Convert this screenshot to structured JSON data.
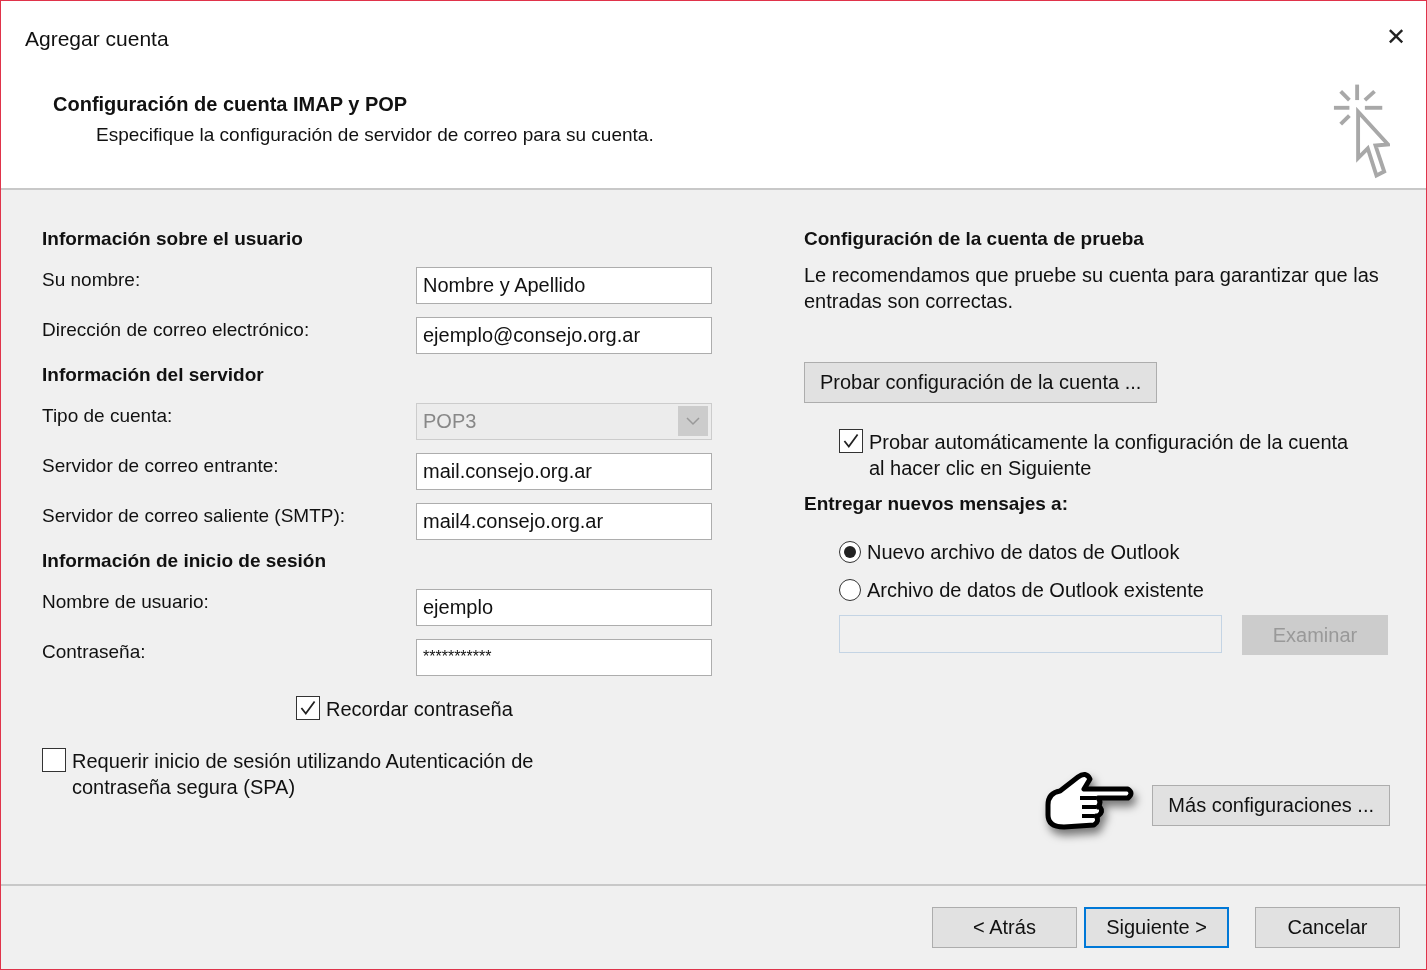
{
  "window": {
    "title": "Agregar cuenta",
    "close": "✕"
  },
  "header": {
    "title": "Configuración de cuenta IMAP y POP",
    "subtitle": "Especifique la configuración de servidor de correo para su cuenta."
  },
  "sections": [
    {
      "heading": "Información sobre el usuario",
      "fields": [
        {
          "kind": "text",
          "label": "Su nombre:",
          "value": "Nombre y Apellido"
        },
        {
          "kind": "text",
          "label": "Dirección de correo electrónico:",
          "value": "ejemplo@consejo.org.ar"
        }
      ]
    },
    {
      "heading": "Información del servidor",
      "fields": [
        {
          "kind": "combo",
          "label": "Tipo de cuenta:",
          "value": "POP3",
          "disabled": true
        },
        {
          "kind": "text",
          "label": "Servidor de correo entrante:",
          "value": "mail.consejo.org.ar"
        },
        {
          "kind": "text",
          "label": "Servidor de correo saliente (SMTP):",
          "value": "mail4.consejo.org.ar"
        }
      ]
    },
    {
      "heading": "Información de inicio de sesión",
      "fields": [
        {
          "kind": "text",
          "label": "Nombre de usuario:",
          "value": "ejemplo"
        },
        {
          "kind": "password",
          "label": "Contraseña:",
          "value": "***********"
        }
      ]
    }
  ],
  "remember_password": {
    "label": "Recordar contraseña",
    "checked": true
  },
  "spa": {
    "label": "Requerir inicio de sesión utilizando Autenticación de contraseña segura (SPA)",
    "checked": false
  },
  "test": {
    "heading": "Configuración de la cuenta de prueba",
    "description": "Le recomendamos que pruebe su cuenta para garantizar que las entradas son correctas.",
    "button": "Probar configuración de la cuenta ...",
    "auto_test": {
      "label": "Probar automáticamente la configuración de la cuenta al hacer clic en Siguiente",
      "checked": true
    }
  },
  "delivery": {
    "heading": "Entregar nuevos mensajes a:",
    "options": [
      {
        "label": "Nuevo archivo de datos de Outlook",
        "selected": true
      },
      {
        "label": "Archivo de datos de Outlook existente",
        "selected": false
      }
    ],
    "path_disabled": true,
    "browse": {
      "label": "Examinar",
      "disabled": true
    }
  },
  "more_settings": "Más configuraciones ...",
  "footer_buttons": [
    {
      "label": "< Atrás",
      "default": false
    },
    {
      "label": "Siguiente >",
      "default": true
    },
    {
      "label": "Cancelar",
      "default": false
    }
  ]
}
